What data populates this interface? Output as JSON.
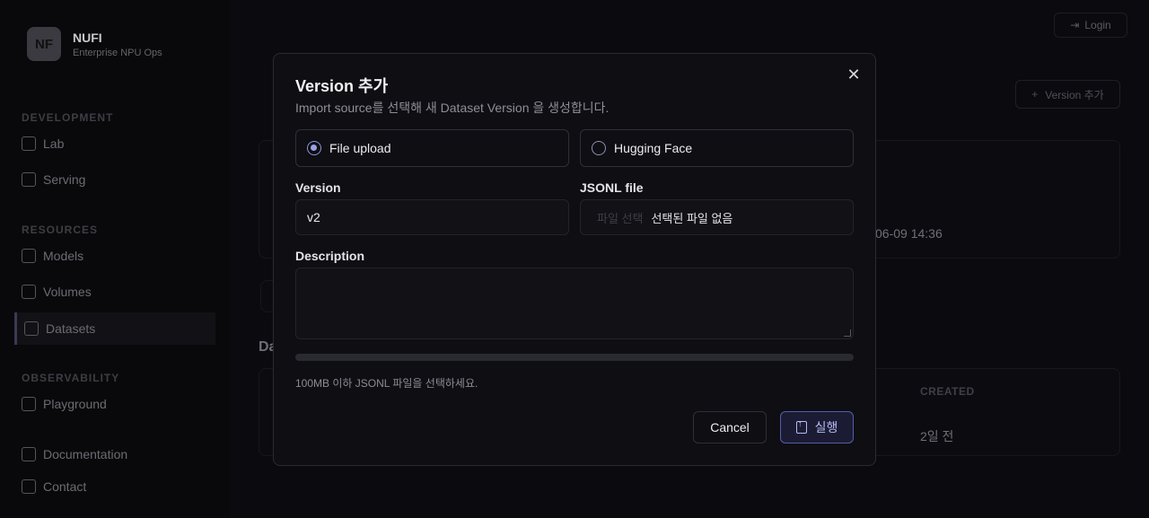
{
  "app": {
    "brand_name": "NUFI",
    "brand_sub": "Enterprise NPU Ops",
    "logo_text": "NF",
    "login_label": "Login",
    "version_add_label": "Version 추가"
  },
  "sidebar": {
    "sections": [
      {
        "title": "DEVELOPMENT",
        "items": [
          "Lab",
          "Serving"
        ]
      },
      {
        "title": "RESOURCES",
        "items": [
          "Models",
          "Volumes",
          "Datasets"
        ]
      },
      {
        "title": "OBSERVABILITY",
        "items": [
          "Playground"
        ]
      }
    ],
    "footer": [
      "Documentation",
      "Contact"
    ]
  },
  "background": {
    "timestamp": "06-09 14:36",
    "section_fragment": "Da",
    "column_created": "CREATED",
    "created_value": "2일 전"
  },
  "modal": {
    "title": "Version 추가",
    "subtitle": "Import source를 선택해 새 Dataset Version 을 생성합니다.",
    "sources": [
      {
        "label": "File upload",
        "selected": true
      },
      {
        "label": "Hugging Face",
        "selected": false
      }
    ],
    "version_label": "Version",
    "version_value": "v2",
    "file_label": "JSONL file",
    "file_button": "파일 선택",
    "file_status": "선택된 파일 없음",
    "description_label": "Description",
    "description_value": "",
    "progress": 0,
    "hint": "100MB 이하 JSONL 파일을 선택하세요.",
    "cancel_label": "Cancel",
    "run_label": "실행",
    "close_icon": "close-icon"
  },
  "colors": {
    "accent": "#8e93d8",
    "primary_button_bg": "#1b1c33",
    "background": "#0b0b0f"
  }
}
